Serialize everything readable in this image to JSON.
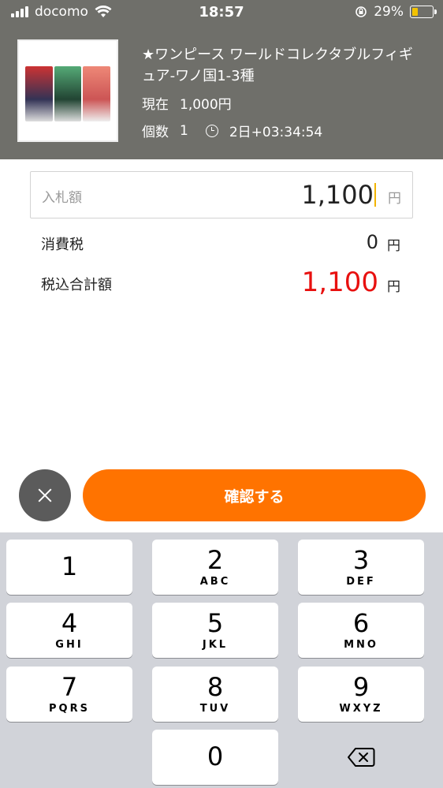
{
  "status_bar": {
    "carrier": "docomo",
    "time": "18:57",
    "battery_percent": "29%",
    "battery_level": 0.29
  },
  "product": {
    "title": "★ワンピース ワールドコレクタブルフィギュア-ワノ国1-3種",
    "current_label": "現在",
    "current_price": "1,000円",
    "quantity_label": "個数",
    "quantity": "1",
    "time_left": "2日+03:34:54"
  },
  "bid": {
    "label": "入札額",
    "value": "1,100",
    "unit": "円"
  },
  "tax": {
    "label": "消費税",
    "value": "0",
    "unit": "円"
  },
  "total": {
    "label": "税込合計額",
    "value": "1,100",
    "unit": "円",
    "color": "#e8100f"
  },
  "actions": {
    "confirm_label": "確認する",
    "confirm_color": "#ff7300"
  },
  "keypad": {
    "keys": [
      {
        "num": "1",
        "letters": ""
      },
      {
        "num": "2",
        "letters": "ABC"
      },
      {
        "num": "3",
        "letters": "DEF"
      },
      {
        "num": "4",
        "letters": "GHI"
      },
      {
        "num": "5",
        "letters": "JKL"
      },
      {
        "num": "6",
        "letters": "MNO"
      },
      {
        "num": "7",
        "letters": "PQRS"
      },
      {
        "num": "8",
        "letters": "TUV"
      },
      {
        "num": "9",
        "letters": "WXYZ"
      },
      {
        "num": "0",
        "letters": ""
      }
    ],
    "delete_icon": "backspace-icon"
  }
}
